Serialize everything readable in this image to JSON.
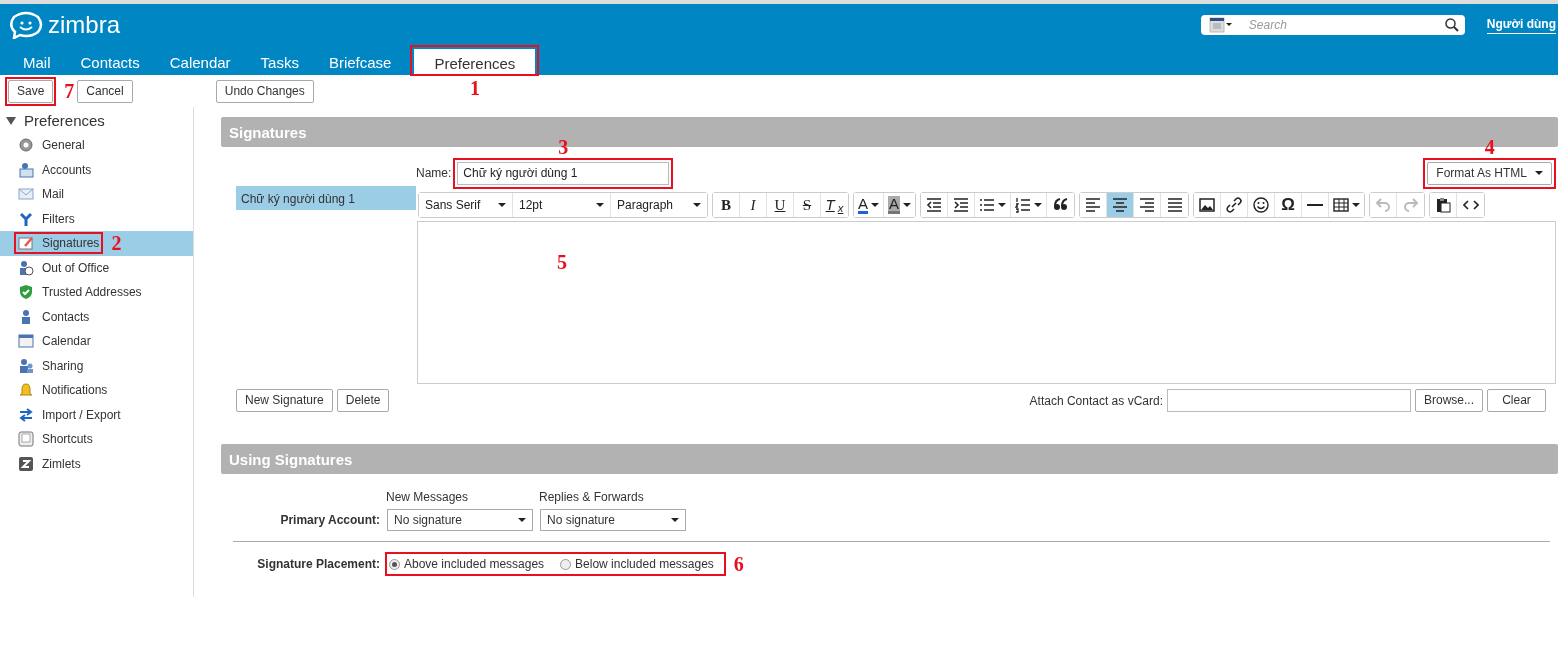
{
  "app": {
    "logo_text": "zimbra",
    "search": {
      "placeholder": "Search"
    },
    "user": "Người dùng"
  },
  "tabs": [
    {
      "label": "Mail",
      "selected": false
    },
    {
      "label": "Contacts",
      "selected": false
    },
    {
      "label": "Calendar",
      "selected": false
    },
    {
      "label": "Tasks",
      "selected": false
    },
    {
      "label": "Briefcase",
      "selected": false
    },
    {
      "label": "Preferences",
      "selected": true,
      "annotation": "1"
    }
  ],
  "actions": [
    {
      "label": "Save",
      "annotation": "7"
    },
    {
      "label": "Cancel"
    },
    {
      "label": "Undo Changes"
    }
  ],
  "sidebar": {
    "title": "Preferences",
    "expanded": true,
    "items": [
      {
        "label": "General",
        "selected": false
      },
      {
        "label": "Accounts",
        "selected": false
      },
      {
        "label": "Mail",
        "selected": false
      },
      {
        "label": "Filters",
        "selected": false
      },
      {
        "label": "Signatures",
        "selected": true,
        "annotation": "2"
      },
      {
        "label": "Out of Office",
        "selected": false
      },
      {
        "label": "Trusted Addresses",
        "selected": false
      },
      {
        "label": "Contacts",
        "selected": false
      },
      {
        "label": "Calendar",
        "selected": false
      },
      {
        "label": "Sharing",
        "selected": false
      },
      {
        "label": "Notifications",
        "selected": false
      },
      {
        "label": "Import / Export",
        "selected": false
      },
      {
        "label": "Shortcuts",
        "selected": false
      },
      {
        "label": "Zimlets",
        "selected": false
      }
    ]
  },
  "signatures": {
    "title": "Signatures",
    "list": [
      {
        "label": "Chữ ký người dùng 1",
        "selected": true
      }
    ],
    "name_label": "Name:",
    "name_value": "Chữ ký người dùng 1",
    "name_annotation": "3",
    "format": {
      "label": "Format As HTML",
      "annotation": "4"
    },
    "toolbar": [
      [
        {
          "kind": "select",
          "text": "Sans Serif"
        },
        {
          "kind": "select",
          "text": "12pt"
        },
        {
          "kind": "select",
          "text": "Paragraph"
        }
      ],
      [
        {
          "kind": "bold",
          "text": "B"
        },
        {
          "kind": "italic",
          "text": "I"
        },
        {
          "kind": "underline",
          "text": "U"
        },
        {
          "kind": "strike",
          "text": "S"
        },
        {
          "kind": "clear",
          "text": "T$_{x}$"
        }
      ],
      [
        {
          "kind": "textcolor",
          "text": "A"
        },
        {
          "kind": "bgcolor",
          "text": "A"
        }
      ],
      [
        {
          "kind": "icon"
        },
        {
          "kind": "icon"
        },
        {
          "kind": "icon",
          "dropdown": true
        },
        {
          "kind": "icon",
          "dropdown": true
        },
        {
          "kind": "icon"
        }
      ],
      [
        {
          "kind": "icon",
          "selected": false
        },
        {
          "kind": "icon",
          "selected": true
        },
        {
          "kind": "icon",
          "selected": false
        },
        {
          "kind": "icon",
          "selected": false
        }
      ],
      [
        {
          "kind": "icon"
        },
        {
          "kind": "icon"
        },
        {
          "kind": "icon"
        },
        {
          "kind": "char",
          "text": "Ω"
        },
        {
          "kind": "icon"
        },
        {
          "kind": "icon",
          "dropdown": true
        }
      ],
      [
        {
          "kind": "icon",
          "disabled": true
        },
        {
          "kind": "icon",
          "disabled": true
        }
      ],
      [
        {
          "kind": "icon"
        },
        {
          "kind": "icon"
        }
      ]
    ],
    "editor_annotation": "5",
    "buttons": [
      "New Signature",
      "Delete"
    ],
    "vcard_label": "Attach Contact as vCard:",
    "vcard_buttons": [
      "Browse...",
      "Clear"
    ]
  },
  "using": {
    "title": "Using Signatures",
    "columns": [
      "New Messages",
      "Replies & Forwards"
    ],
    "primary_label": "Primary Account:",
    "primary_values": [
      "No signature",
      "No signature"
    ],
    "placement_label": "Signature Placement:",
    "placement_annotation": "6",
    "placement": [
      {
        "label": "Above included messages",
        "selected": true
      },
      {
        "label": "Below included messages",
        "selected": false
      }
    ]
  }
}
